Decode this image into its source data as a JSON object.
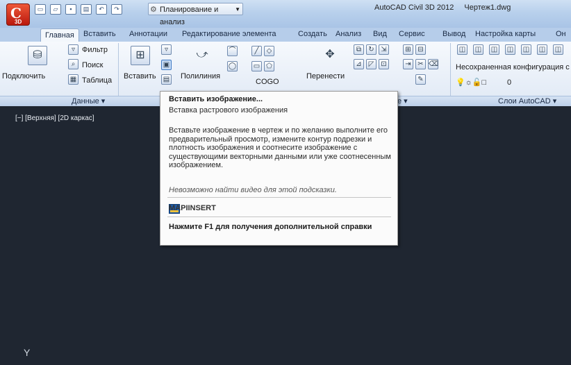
{
  "titlebar": {
    "app_letter": "C",
    "app_sub": "3D",
    "workspace": "Планирование и анализ",
    "app_title": "AutoCAD Civil 3D 2012",
    "file_title": "Чертеж1.dwg"
  },
  "tabs": [
    {
      "label": "Главная",
      "active": true
    },
    {
      "label": "Вставить"
    },
    {
      "label": "Аннотации"
    },
    {
      "label": "Редактирование элемента"
    },
    {
      "label": "Создать"
    },
    {
      "label": "Анализ"
    },
    {
      "label": "Вид"
    },
    {
      "label": "Сервис"
    },
    {
      "label": "Вывод"
    },
    {
      "label": "Настройка карты"
    },
    {
      "label": "Он"
    }
  ],
  "ribbon": {
    "connect": "Подключить",
    "filter": "Фильтр",
    "search": "Поиск",
    "table": "Таблица",
    "insert": "Вставить",
    "polyline": "Полилиния",
    "cogo": "COGO",
    "move": "Перенести",
    "layer_config": "Несохраненная конфигурация с",
    "layer_zero": "0"
  },
  "panels": {
    "data": "Данные ▾",
    "layers": "Слои AutoCAD ▾",
    "partial": "е ▾"
  },
  "viewport": {
    "label": "[−] [Верхняя] [2D каркас]",
    "ucs": "Y"
  },
  "tooltip": {
    "title": "Вставить изображение...",
    "subtitle": "Вставка растрового изображения",
    "description": "Вставьте изображение в чертеж и по желанию выполните его предварительный просмотр, измените контур подрезки и плотность изображения и соотнесите изображение с существующими векторными данными или уже соотнесенным изображением.",
    "no_video": "Невозможно найти видео для этой подсказки.",
    "command": "MAPIINSERT",
    "help": "Нажмите F1 для получения дополнительной справки"
  }
}
